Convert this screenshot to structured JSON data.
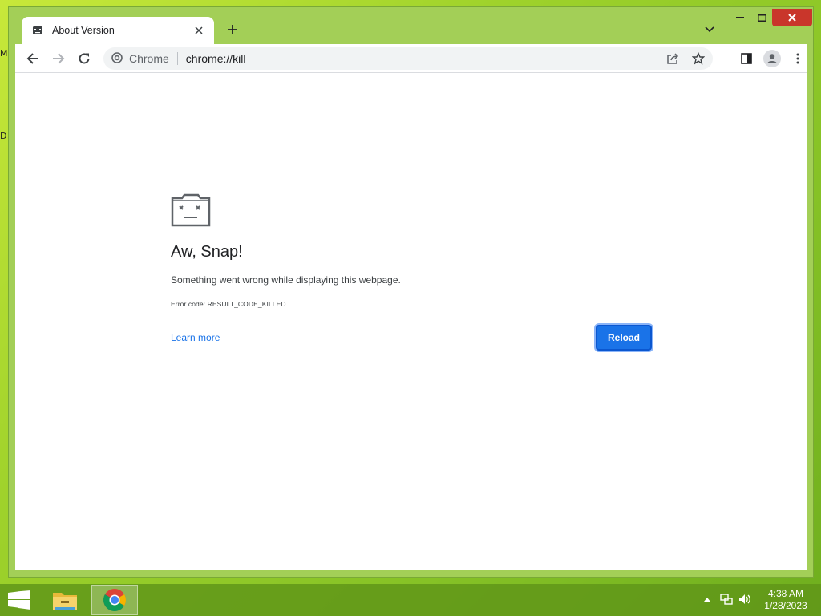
{
  "desktop": {
    "fragment_1": "M",
    "fragment_2": "D"
  },
  "browser": {
    "tab": {
      "title": "About Version"
    },
    "omnibox": {
      "chip_label": "Chrome",
      "url": "chrome://kill"
    }
  },
  "page": {
    "title": "Aw, Snap!",
    "message": "Something went wrong while displaying this webpage.",
    "error_code": "Error code: RESULT_CODE_KILLED",
    "learn_more": "Learn more",
    "reload": "Reload"
  },
  "taskbar": {
    "apps": [
      "file-explorer",
      "chrome"
    ],
    "time": "4:38 AM",
    "date": "1/28/2023"
  },
  "colors": {
    "accent": "#1a73e8",
    "frame": "#a3cf57",
    "close": "#c9362b"
  }
}
